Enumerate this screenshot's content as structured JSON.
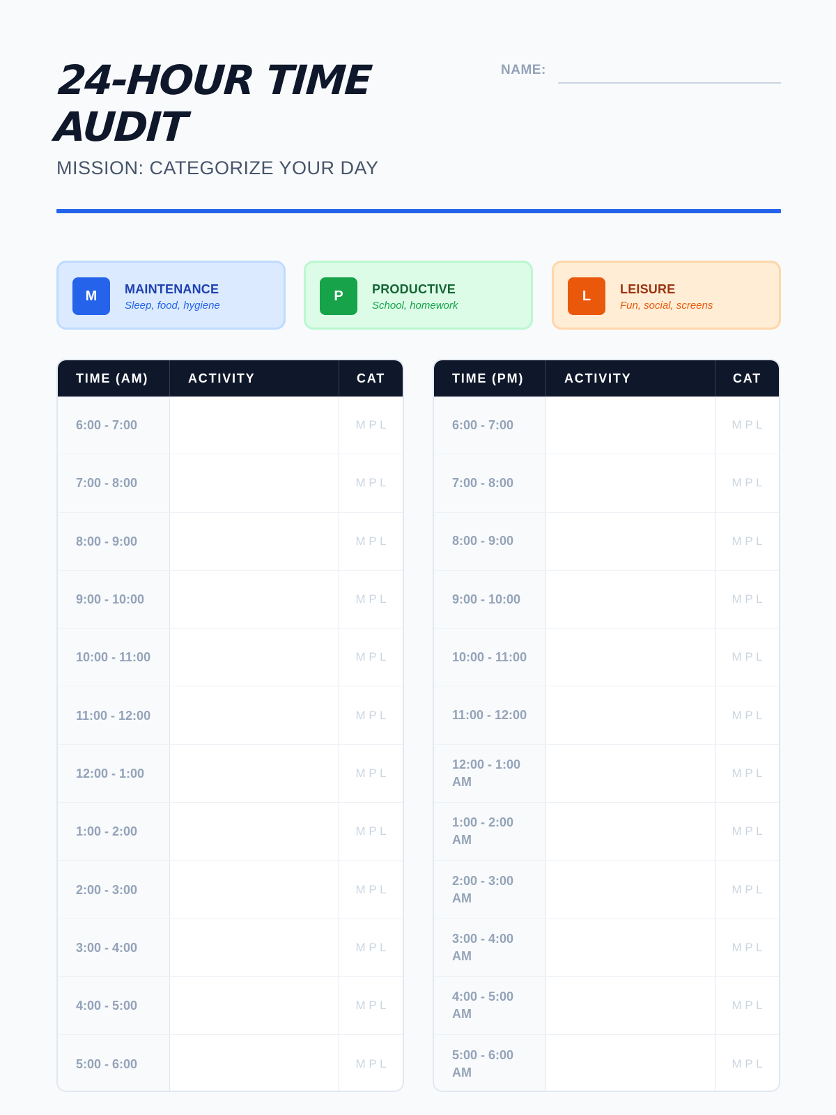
{
  "header": {
    "title": "24-HOUR TIME AUDIT",
    "subtitle": "MISSION: CATEGORIZE YOUR DAY",
    "name_label": "NAME:"
  },
  "legend": [
    {
      "letter": "M",
      "name": "MAINTENANCE",
      "desc": "Sleep, food, hygiene",
      "color": "#2563eb"
    },
    {
      "letter": "P",
      "name": "PRODUCTIVE",
      "desc": "School, homework",
      "color": "#16a34a"
    },
    {
      "letter": "L",
      "name": "LEISURE",
      "desc": "Fun, social, screens",
      "color": "#ea580c"
    }
  ],
  "am_table": {
    "headers": {
      "time": "TIME (AM)",
      "activity": "ACTIVITY",
      "cat": "CAT"
    },
    "rows": [
      {
        "time": "6:00 - 7:00",
        "cat": "M P L"
      },
      {
        "time": "7:00 - 8:00",
        "cat": "M P L"
      },
      {
        "time": "8:00 - 9:00",
        "cat": "M P L"
      },
      {
        "time": "9:00 - 10:00",
        "cat": "M P L"
      },
      {
        "time": "10:00 - 11:00",
        "cat": "M P L"
      },
      {
        "time": "11:00 - 12:00",
        "cat": "M P L"
      },
      {
        "time": "12:00 - 1:00",
        "cat": "M P L"
      },
      {
        "time": "1:00 - 2:00",
        "cat": "M P L"
      },
      {
        "time": "2:00 - 3:00",
        "cat": "M P L"
      },
      {
        "time": "3:00 - 4:00",
        "cat": "M P L"
      },
      {
        "time": "4:00 - 5:00",
        "cat": "M P L"
      },
      {
        "time": "5:00 - 6:00",
        "cat": "M P L"
      }
    ]
  },
  "pm_table": {
    "headers": {
      "time": "TIME (PM)",
      "activity": "ACTIVITY",
      "cat": "CAT"
    },
    "rows": [
      {
        "time": "6:00 - 7:00",
        "cat": "M P L"
      },
      {
        "time": "7:00 - 8:00",
        "cat": "M P L"
      },
      {
        "time": "8:00 - 9:00",
        "cat": "M P L"
      },
      {
        "time": "9:00 - 10:00",
        "cat": "M P L"
      },
      {
        "time": "10:00 - 11:00",
        "cat": "M P L"
      },
      {
        "time": "11:00 - 12:00",
        "cat": "M P L"
      },
      {
        "time": "12:00 - 1:00 AM",
        "cat": "M P L"
      },
      {
        "time": "1:00 - 2:00 AM",
        "cat": "M P L"
      },
      {
        "time": "2:00 - 3:00 AM",
        "cat": "M P L"
      },
      {
        "time": "3:00 - 4:00 AM",
        "cat": "M P L"
      },
      {
        "time": "4:00 - 5:00 AM",
        "cat": "M P L"
      },
      {
        "time": "5:00 - 6:00 AM",
        "cat": "M P L"
      }
    ]
  }
}
